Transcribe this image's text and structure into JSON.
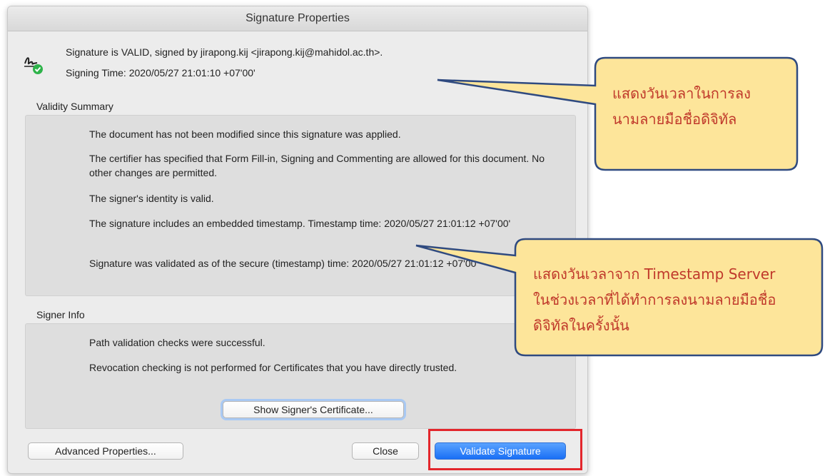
{
  "dialog": {
    "title": "Signature Properties",
    "status": "Signature is VALID, signed by jirapong.kij <jirapong.kij@mahidol.ac.th>.",
    "signing_time": "Signing Time:  2020/05/27 21:01:10 +07'00'"
  },
  "validity_summary": {
    "label": "Validity Summary",
    "lines": [
      "The document has not been modified since this signature was applied.",
      "The certifier has specified that Form Fill-in, Signing and Commenting are allowed for this document. No other changes are permitted.",
      "The signer's identity is valid.",
      "The signature includes an embedded timestamp. Timestamp time: 2020/05/27 21:01:12 +07'00'",
      "Signature was validated as of the secure (timestamp) time: 2020/05/27 21:01:12 +07'00'"
    ]
  },
  "signer_info": {
    "label": "Signer Info",
    "lines": [
      "Path validation checks were successful.",
      "Revocation checking is not performed for Certificates that you have directly trusted."
    ],
    "show_certificate_button": "Show Signer's Certificate..."
  },
  "buttons": {
    "advanced": "Advanced Properties...",
    "close": "Close",
    "validate": "Validate Signature"
  },
  "callouts": {
    "signing_time": {
      "line1": "แสดงวันเวลาในการลง",
      "line2": "นามลายมือชื่อดิจิทัล"
    },
    "timestamp": {
      "line1": "แสดงวันเวลาจาก Timestamp Server",
      "line2": "ในช่วงเวลาที่ได้ทำการลงนามลายมือชื่อ",
      "line3": "ดิจิทัลในครั้งนั้น"
    }
  },
  "colors": {
    "callout_fill": "#fde59a",
    "callout_border": "#2f4a80",
    "callout_text": "#c0392b",
    "highlight": "#e3262c",
    "primary_button": "#1a6ff5"
  },
  "icons": {
    "signature": "signature-valid-icon"
  }
}
